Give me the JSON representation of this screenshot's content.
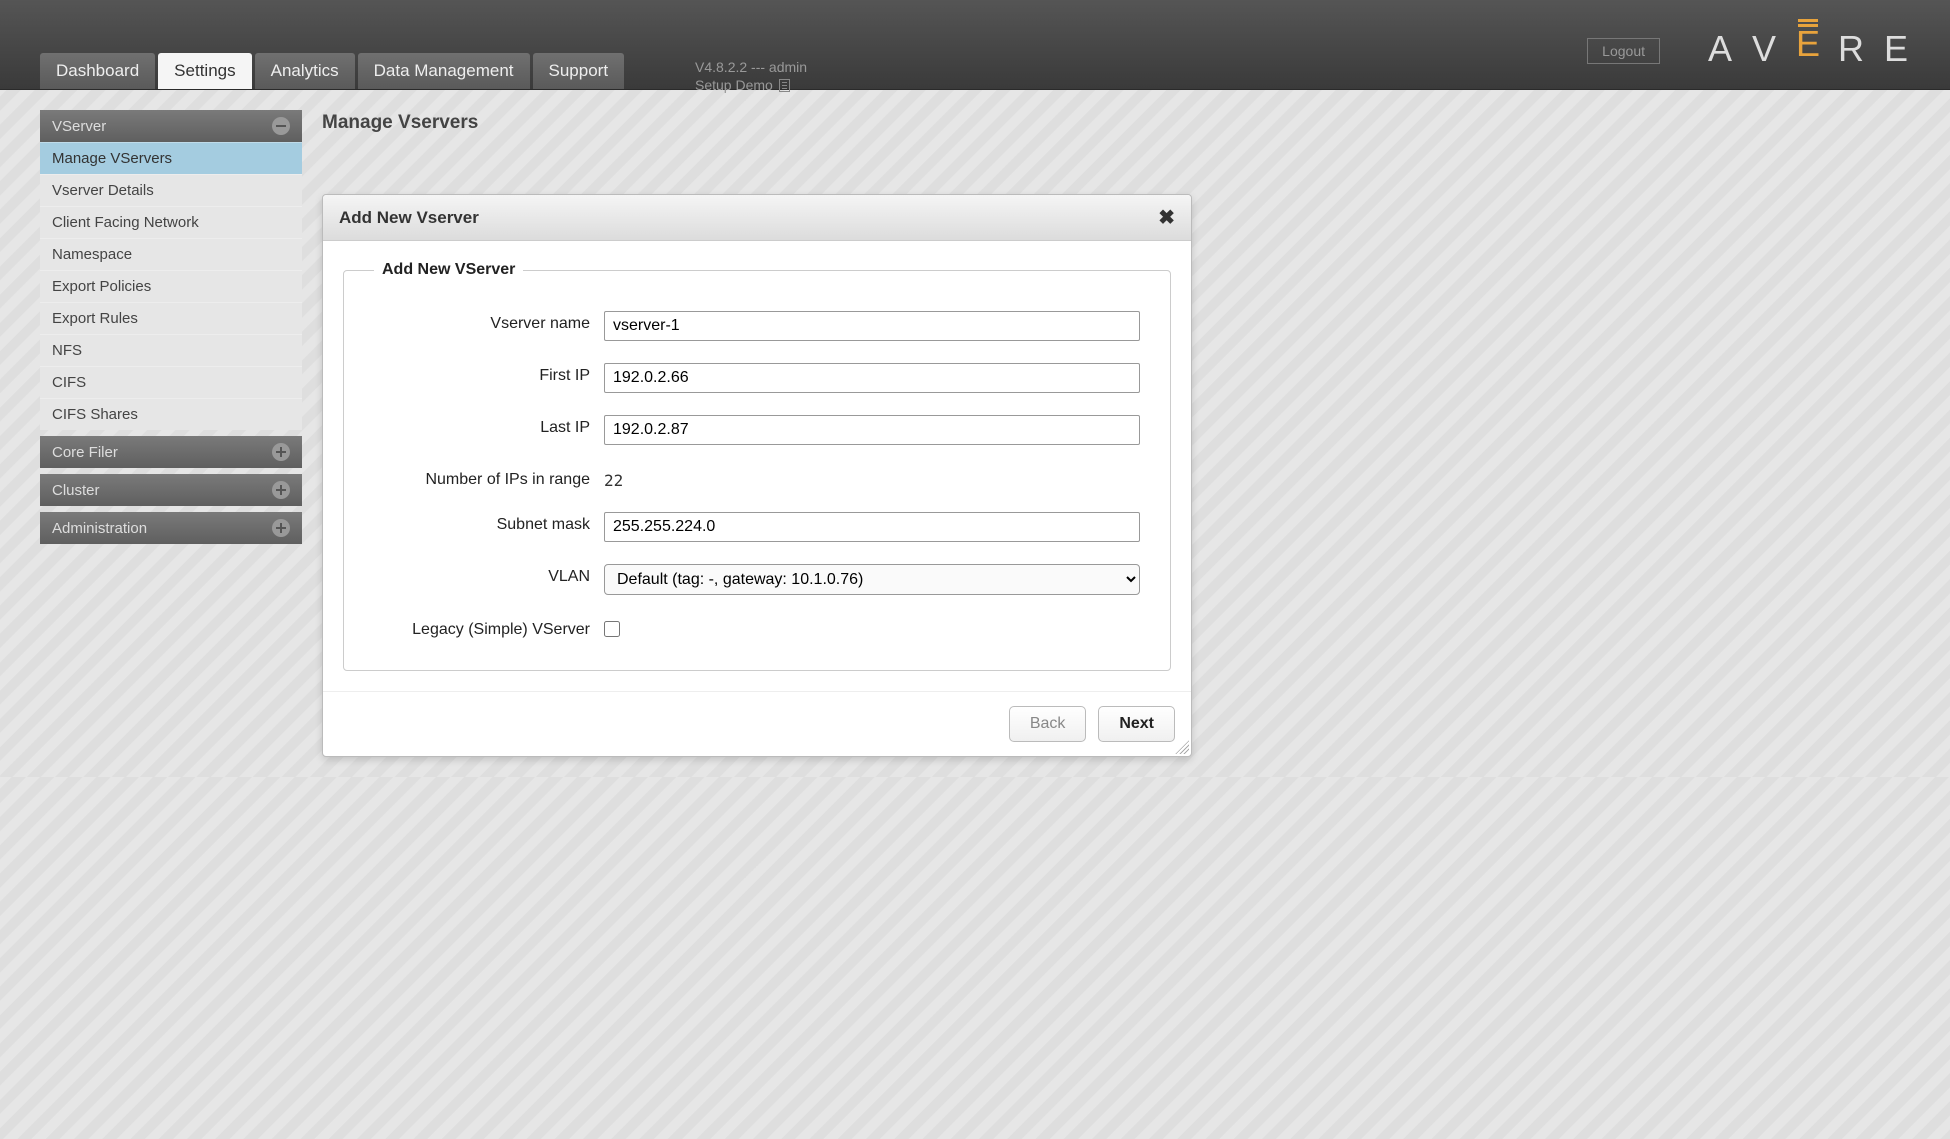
{
  "logo": {
    "letters": [
      "A",
      "V",
      "E",
      "R",
      "E"
    ],
    "accent_index": 2
  },
  "logout_label": "Logout",
  "version_line1": "V4.8.2.2 --- admin",
  "version_line2": "Setup Demo",
  "tabs": [
    {
      "label": "Dashboard",
      "active": false
    },
    {
      "label": "Settings",
      "active": true
    },
    {
      "label": "Analytics",
      "active": false
    },
    {
      "label": "Data Management",
      "active": false
    },
    {
      "label": "Support",
      "active": false
    }
  ],
  "sidebar": {
    "groups": [
      {
        "label": "VServer",
        "expanded": true,
        "items": [
          {
            "label": "Manage VServers",
            "active": true
          },
          {
            "label": "Vserver Details"
          },
          {
            "label": "Client Facing Network"
          },
          {
            "label": "Namespace"
          },
          {
            "label": "Export Policies"
          },
          {
            "label": "Export Rules"
          },
          {
            "label": "NFS"
          },
          {
            "label": "CIFS"
          },
          {
            "label": "CIFS Shares"
          }
        ]
      },
      {
        "label": "Core Filer",
        "expanded": false
      },
      {
        "label": "Cluster",
        "expanded": false
      },
      {
        "label": "Administration",
        "expanded": false
      }
    ]
  },
  "page": {
    "title": "Manage Vservers"
  },
  "dialog": {
    "title": "Add New Vserver",
    "legend": "Add New VServer",
    "fields": {
      "vserver_name": {
        "label": "Vserver name",
        "value": "vserver-1"
      },
      "first_ip": {
        "label": "First IP",
        "value": "192.0.2.66"
      },
      "last_ip": {
        "label": "Last IP",
        "value": "192.0.2.87"
      },
      "num_ips": {
        "label": "Number of IPs in range",
        "value": "22"
      },
      "subnet_mask": {
        "label": "Subnet mask",
        "value": "255.255.224.0"
      },
      "vlan": {
        "label": "VLAN",
        "selected": "Default (tag: -, gateway: 10.1.0.76)"
      },
      "legacy": {
        "label": "Legacy (Simple) VServer",
        "checked": false
      }
    },
    "buttons": {
      "back": "Back",
      "next": "Next"
    }
  }
}
